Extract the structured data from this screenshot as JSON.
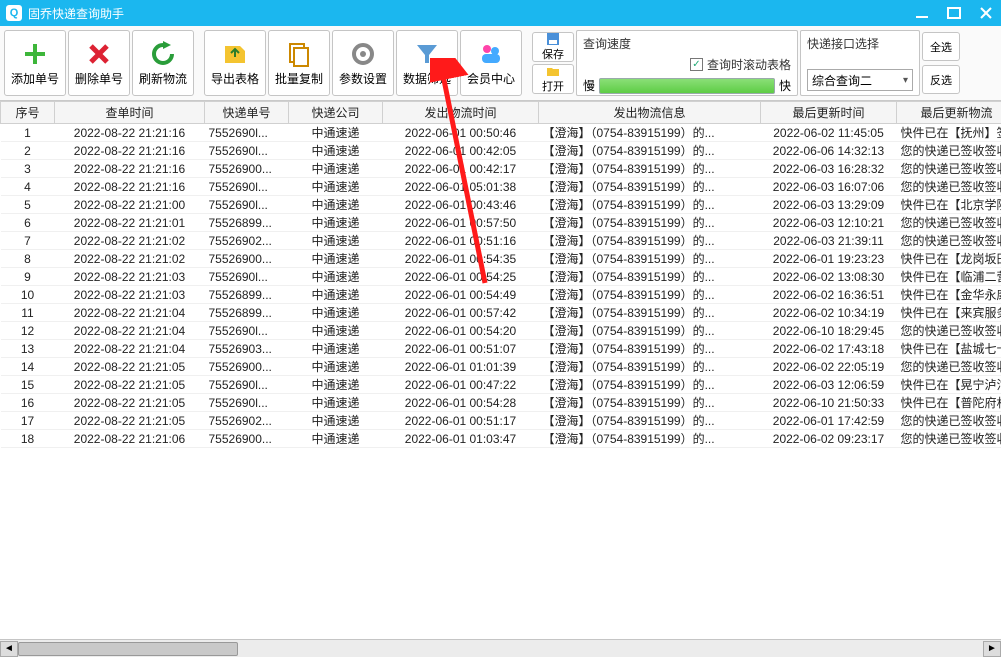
{
  "window": {
    "title": "固乔快递查询助手"
  },
  "toolbar": {
    "add": "添加单号",
    "delete": "删除单号",
    "refresh": "刷新物流",
    "export": "导出表格",
    "copy": "批量复制",
    "settings": "参数设置",
    "filter": "数据筛选",
    "member": "会员中心",
    "save": "保存",
    "open": "打开"
  },
  "speed": {
    "title": "查询速度",
    "scroll_checkbox": "查询时滚动表格",
    "slow": "慢",
    "fast": "快"
  },
  "iface": {
    "title": "快递接口选择",
    "selected": "综合查询二",
    "select_all": "全选",
    "invert": "反选"
  },
  "columns": [
    "序号",
    "查单时间",
    "快递单号",
    "快递公司",
    "发出物流时间",
    "发出物流信息",
    "最后更新时间",
    "最后更新物流"
  ],
  "rows": [
    {
      "n": "1",
      "qt": "2022-08-22 21:21:16",
      "no": "7552690l...",
      "co": "中通速递",
      "ft": "2022-06-01 00:50:46",
      "fi": "【澄海】（0754-83915199）的...",
      "ut": "2022-06-02 11:45:05",
      "ui": "快件已在【抚州】签"
    },
    {
      "n": "2",
      "qt": "2022-08-22 21:21:16",
      "no": "7552690l...",
      "co": "中通速递",
      "ft": "2022-06-01 00:42:05",
      "fi": "【澄海】（0754-83915199）的...",
      "ut": "2022-06-06 14:32:13",
      "ui": "您的快递已签收签收"
    },
    {
      "n": "3",
      "qt": "2022-08-22 21:21:16",
      "no": "75526900...",
      "co": "中通速递",
      "ft": "2022-06-01 00:42:17",
      "fi": "【澄海】（0754-83915199）的...",
      "ut": "2022-06-03 16:28:32",
      "ui": "您的快递已签收签收"
    },
    {
      "n": "4",
      "qt": "2022-08-22 21:21:16",
      "no": "7552690l...",
      "co": "中通速递",
      "ft": "2022-06-01 05:01:38",
      "fi": "【澄海】（0754-83915199）的...",
      "ut": "2022-06-03 16:07:06",
      "ui": "您的快递已签收签收"
    },
    {
      "n": "5",
      "qt": "2022-08-22 21:21:00",
      "no": "7552690l...",
      "co": "中通速递",
      "ft": "2022-06-01 00:43:46",
      "fi": "【澄海】（0754-83915199）的...",
      "ut": "2022-06-03 13:29:09",
      "ui": "快件已在【北京学院"
    },
    {
      "n": "6",
      "qt": "2022-08-22 21:21:01",
      "no": "75526899...",
      "co": "中通速递",
      "ft": "2022-06-01 00:57:50",
      "fi": "【澄海】（0754-83915199）的...",
      "ut": "2022-06-03 12:10:21",
      "ui": "您的快递已签收签收"
    },
    {
      "n": "7",
      "qt": "2022-08-22 21:21:02",
      "no": "75526902...",
      "co": "中通速递",
      "ft": "2022-06-01 00:51:16",
      "fi": "【澄海】（0754-83915199）的...",
      "ut": "2022-06-03 21:39:11",
      "ui": "您的快递已签收签收"
    },
    {
      "n": "8",
      "qt": "2022-08-22 21:21:02",
      "no": "75526900...",
      "co": "中通速递",
      "ft": "2022-06-01 00:54:35",
      "fi": "【澄海】（0754-83915199）的...",
      "ut": "2022-06-01 19:23:23",
      "ui": "快件已在【龙岗坂田"
    },
    {
      "n": "9",
      "qt": "2022-08-22 21:21:03",
      "no": "7552690l...",
      "co": "中通速递",
      "ft": "2022-06-01 00:54:25",
      "fi": "【澄海】（0754-83915199）的...",
      "ut": "2022-06-02 13:08:30",
      "ui": "快件已在【临浦二营"
    },
    {
      "n": "10",
      "qt": "2022-08-22 21:21:03",
      "no": "75526899...",
      "co": "中通速递",
      "ft": "2022-06-01 00:54:49",
      "fi": "【澄海】（0754-83915199）的...",
      "ut": "2022-06-02 16:36:51",
      "ui": "快件已在【金华永康"
    },
    {
      "n": "11",
      "qt": "2022-08-22 21:21:04",
      "no": "75526899...",
      "co": "中通速递",
      "ft": "2022-06-01 00:57:42",
      "fi": "【澄海】（0754-83915199）的...",
      "ut": "2022-06-02 10:34:19",
      "ui": "快件已在【来宾服务"
    },
    {
      "n": "12",
      "qt": "2022-08-22 21:21:04",
      "no": "7552690l...",
      "co": "中通速递",
      "ft": "2022-06-01 00:54:20",
      "fi": "【澄海】（0754-83915199）的...",
      "ut": "2022-06-10 18:29:45",
      "ui": "您的快递已签收签收"
    },
    {
      "n": "13",
      "qt": "2022-08-22 21:21:04",
      "no": "75526903...",
      "co": "中通速递",
      "ft": "2022-06-01 00:51:07",
      "fi": "【澄海】（0754-83915199）的...",
      "ut": "2022-06-02 17:43:18",
      "ui": "快件已在【盐城七十"
    },
    {
      "n": "14",
      "qt": "2022-08-22 21:21:05",
      "no": "75526900...",
      "co": "中通速递",
      "ft": "2022-06-01 01:01:39",
      "fi": "【澄海】（0754-83915199）的...",
      "ut": "2022-06-02 22:05:19",
      "ui": "您的快递已签收签收"
    },
    {
      "n": "15",
      "qt": "2022-08-22 21:21:05",
      "no": "7552690l...",
      "co": "中通速递",
      "ft": "2022-06-01 00:47:22",
      "fi": "【澄海】（0754-83915199）的...",
      "ut": "2022-06-03 12:06:59",
      "ui": "快件已在【晃宁泸沽"
    },
    {
      "n": "16",
      "qt": "2022-08-22 21:21:05",
      "no": "7552690l...",
      "co": "中通速递",
      "ft": "2022-06-01 00:54:28",
      "fi": "【澄海】（0754-83915199）的...",
      "ut": "2022-06-10 21:50:33",
      "ui": "快件已在【普陀府村"
    },
    {
      "n": "17",
      "qt": "2022-08-22 21:21:05",
      "no": "75526902...",
      "co": "中通速递",
      "ft": "2022-06-01 00:51:17",
      "fi": "【澄海】（0754-83915199）的...",
      "ut": "2022-06-01 17:42:59",
      "ui": "您的快递已签收签收"
    },
    {
      "n": "18",
      "qt": "2022-08-22 21:21:06",
      "no": "75526900...",
      "co": "中通速递",
      "ft": "2022-06-01 01:03:47",
      "fi": "【澄海】（0754-83915199）的...",
      "ut": "2022-06-02 09:23:17",
      "ui": "您的快递已签收签收"
    }
  ]
}
